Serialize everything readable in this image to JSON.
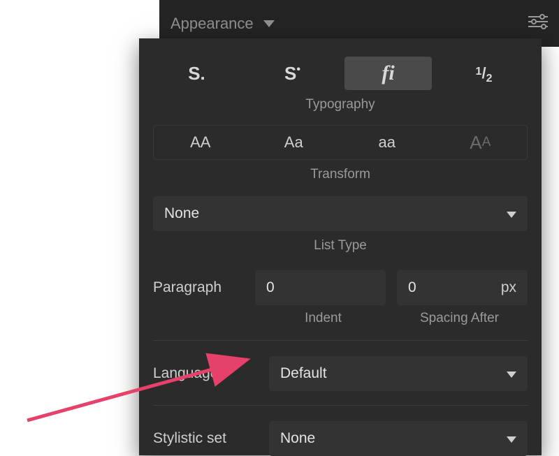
{
  "header": {
    "title": "Appearance"
  },
  "typography_section_label": "Typography",
  "typography_buttons": {
    "s_dot": "S.",
    "s_bullet": "S",
    "fi": "fi",
    "half_num": "1",
    "half_den": "2"
  },
  "transform_section_label": "Transform",
  "transform_buttons": {
    "upper": "AA",
    "title": "Aa",
    "lower": "aa",
    "smallcaps_big": "A",
    "smallcaps_small": "A"
  },
  "list_type": {
    "value": "None",
    "label": "List Type"
  },
  "paragraph": {
    "label": "Paragraph",
    "indent_value": "0",
    "spacing_value": "0",
    "spacing_unit": "px",
    "indent_label": "Indent",
    "spacing_label": "Spacing After"
  },
  "language": {
    "label": "Language",
    "value": "Default"
  },
  "stylistic_set": {
    "label": "Stylistic set",
    "value": "None"
  }
}
